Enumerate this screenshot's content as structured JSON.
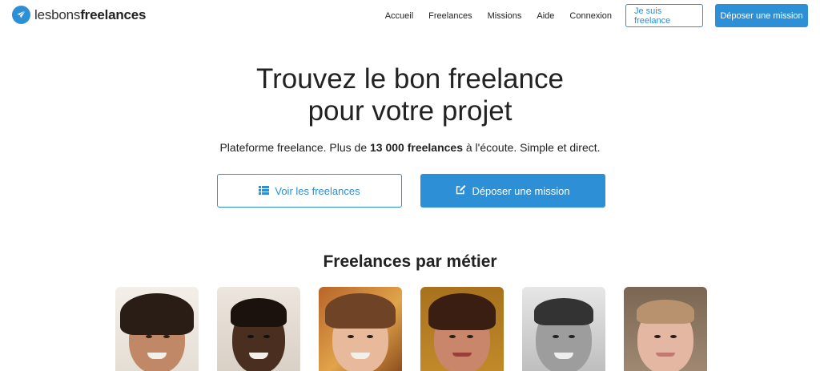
{
  "header": {
    "logo_light": "lesbons",
    "logo_bold": "freelances",
    "nav": [
      "Accueil",
      "Freelances",
      "Missions",
      "Aide",
      "Connexion"
    ],
    "btn_freelance": "Je suis freelance",
    "btn_mission": "Déposer une mission"
  },
  "hero": {
    "title_line1": "Trouvez le bon freelance",
    "title_line2": "pour votre projet",
    "sub_before": "Plateforme freelance. Plus de ",
    "sub_bold": "13 000 freelances",
    "sub_after": " à l'écoute. Simple et direct.",
    "cta_freelances": "Voir les freelances",
    "cta_mission": "Déposer une mission"
  },
  "section": {
    "title": "Freelances par métier"
  },
  "colors": {
    "accent": "#2d8fd6"
  },
  "icons": {
    "logo": "paper-plane-icon",
    "list": "list-icon",
    "edit": "edit-icon"
  }
}
